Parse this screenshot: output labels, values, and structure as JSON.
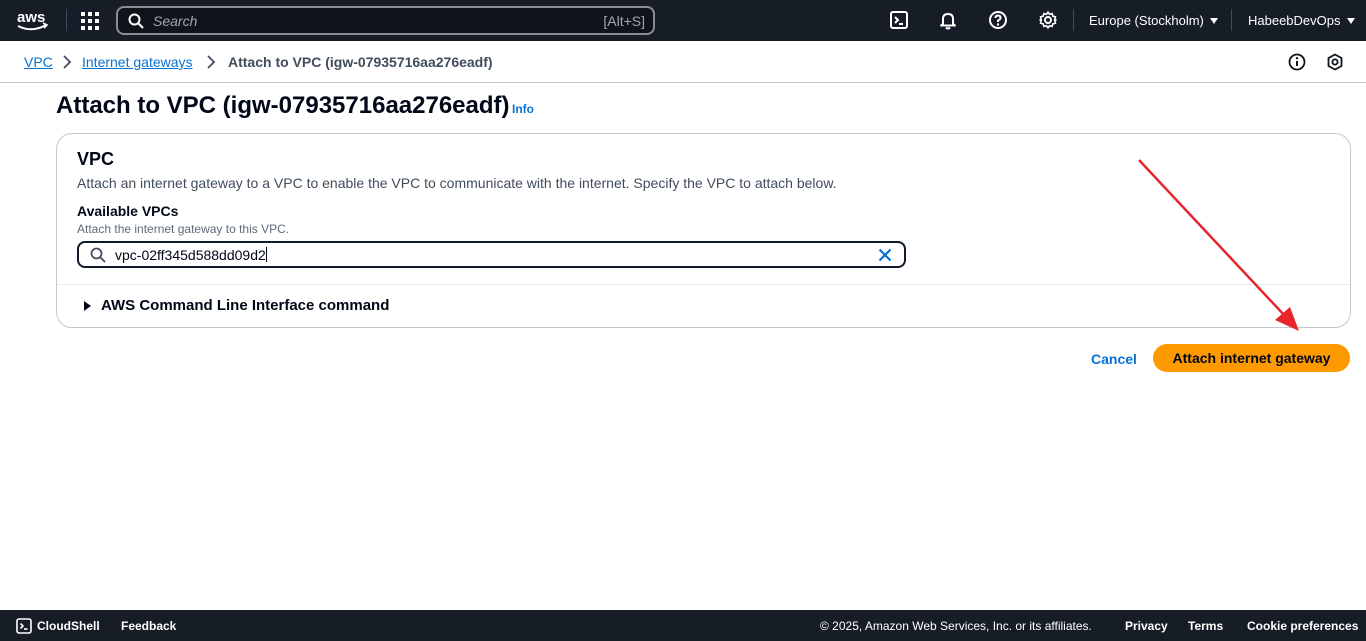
{
  "topnav": {
    "logo_text": "aws",
    "search_placeholder": "Search",
    "search_shortcut": "[Alt+S]",
    "icons": [
      "apps-grid-icon",
      "cloudshell-icon",
      "bell-icon",
      "help-icon",
      "gear-icon"
    ],
    "region": "Europe (Stockholm)",
    "account": "HabeebDevOps"
  },
  "breadcrumb": {
    "items": [
      "VPC",
      "Internet gateways",
      "Attach to VPC (igw-07935716aa276eadf)"
    ]
  },
  "page": {
    "title": "Attach to VPC (igw-07935716aa276eadf)",
    "info_link": "Info"
  },
  "panel": {
    "heading": "VPC",
    "description": "Attach an internet gateway to a VPC to enable the VPC to communicate with the internet. Specify the VPC to attach below.",
    "field_label": "Available VPCs",
    "field_hint": "Attach the internet gateway to this VPC.",
    "field_value": "vpc-02ff345d588dd09d2",
    "expander_label": "AWS Command Line Interface command"
  },
  "actions": {
    "cancel": "Cancel",
    "submit": "Attach internet gateway"
  },
  "footer": {
    "cloudshell": "CloudShell",
    "feedback": "Feedback",
    "copyright": "© 2025, Amazon Web Services, Inc. or its affiliates.",
    "privacy": "Privacy",
    "terms": "Terms",
    "cookies": "Cookie preferences"
  },
  "colors": {
    "nav_bg": "#161d26",
    "link": "#0972d3",
    "primary_button": "#ff9900",
    "annotation_arrow": "#e8242c"
  }
}
